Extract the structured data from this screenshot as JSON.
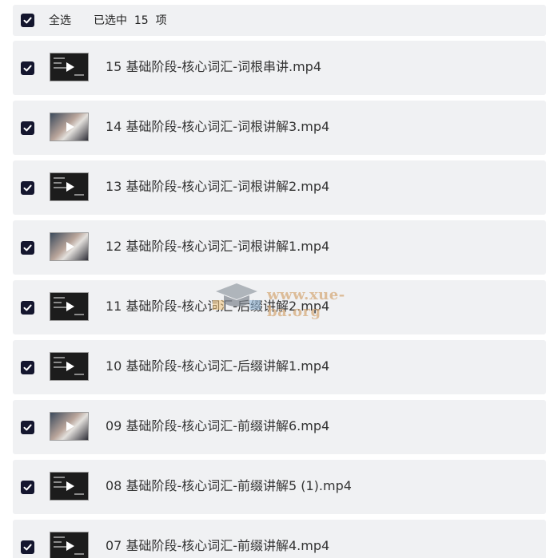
{
  "header": {
    "select_all_label": "全选",
    "selected_text": "已选中  15  项"
  },
  "files": [
    {
      "name": "15 基础阶段-核心词汇-词根串讲.mp4",
      "checked": true,
      "thumb": "dark"
    },
    {
      "name": "14 基础阶段-核心词汇-词根讲解3.mp4",
      "checked": true,
      "thumb": "photo"
    },
    {
      "name": "13 基础阶段-核心词汇-词根讲解2.mp4",
      "checked": true,
      "thumb": "dark"
    },
    {
      "name": "12 基础阶段-核心词汇-词根讲解1.mp4",
      "checked": true,
      "thumb": "photo"
    },
    {
      "name": "11 基础阶段-核心词汇-后缀讲解2.mp4",
      "checked": true,
      "thumb": "dark"
    },
    {
      "name": "10 基础阶段-核心词汇-后缀讲解1.mp4",
      "checked": true,
      "thumb": "dark"
    },
    {
      "name": "09 基础阶段-核心词汇-前缀讲解6.mp4",
      "checked": true,
      "thumb": "photo"
    },
    {
      "name": "08 基础阶段-核心词汇-前缀讲解5 (1).mp4",
      "checked": true,
      "thumb": "dark"
    },
    {
      "name": "07 基础阶段-核心词汇-前缀讲解4.mp4",
      "checked": true,
      "thumb": "dark"
    }
  ],
  "watermark": {
    "text": "www.xue-ba.org",
    "icon": "graduation-cap-icon"
  },
  "colors": {
    "checkbox": "#14162e",
    "row_background": "#f0f1f3",
    "watermark": "#d5a97a"
  }
}
